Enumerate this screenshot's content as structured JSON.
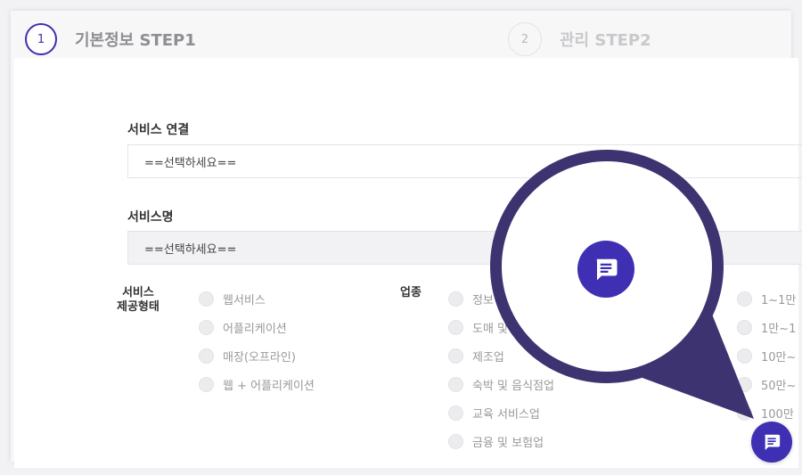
{
  "steps": [
    {
      "number": "1",
      "label": "기본정보 STEP1"
    },
    {
      "number": "2",
      "label": "관리 STEP2"
    }
  ],
  "form": {
    "service_link": {
      "label": "서비스 연결",
      "value": "==선택하세요=="
    },
    "service_name": {
      "label": "서비스명",
      "value": "==선택하세요=="
    }
  },
  "groups": {
    "service_type": {
      "label_line1": "서비스",
      "label_line2": "제공형태",
      "options": [
        "웹서비스",
        "어플리케이션",
        "매장(오프라인)",
        "웹 + 어플리케이션"
      ]
    },
    "industry": {
      "label": "업종",
      "options": [
        "정보",
        "도매 및",
        "제조업",
        "숙박 및 음식점업",
        "교육 서비스업",
        "금융 및 보험업"
      ]
    },
    "users": {
      "options": [
        "1~1만",
        "1만~1",
        "10만~",
        "50만~",
        "100만"
      ]
    }
  },
  "icons": {
    "zoom_chat": "chat-icon",
    "floating_chat": "chat-icon"
  },
  "colors": {
    "accent": "#3e2fb3",
    "magnifier_ring": "#3d3370"
  }
}
